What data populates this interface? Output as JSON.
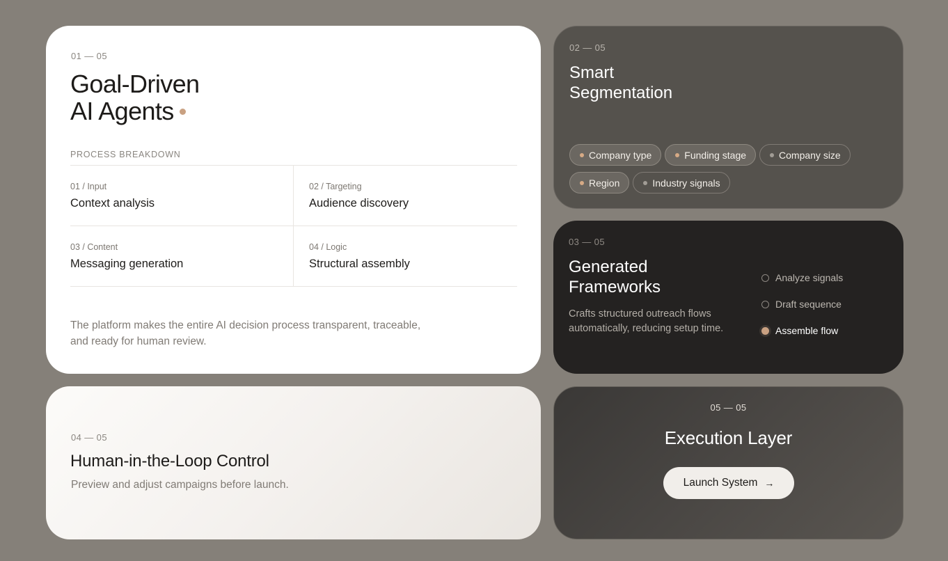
{
  "card1": {
    "step": "01 — 05",
    "title_line1": "Goal-Driven",
    "title_line2": "AI Agents",
    "section_label": "PROCESS BREAKDOWN",
    "cells": [
      {
        "caption": "01 / Input",
        "value": "Context analysis"
      },
      {
        "caption": "02 / Targeting",
        "value": "Audience discovery"
      },
      {
        "caption": "03 / Content",
        "value": "Messaging generation"
      },
      {
        "caption": "04 / Logic",
        "value": "Structural assembly"
      }
    ],
    "description": "The platform makes the entire AI decision process transparent, traceable, and ready for human review.",
    "accent_color": "#c9a182"
  },
  "card2": {
    "step": "02 — 05",
    "title_line1": "Smart",
    "title_line2": "Segmentation",
    "chips": [
      {
        "label": "Company type",
        "active": true
      },
      {
        "label": "Funding stage",
        "active": true
      },
      {
        "label": "Company size",
        "active": false
      },
      {
        "label": "Region",
        "active": true
      },
      {
        "label": "Industry signals",
        "active": false
      }
    ],
    "active_dot_color": "#d6aa85",
    "inactive_dot_color": "#a19c95"
  },
  "card3": {
    "step": "03 — 05",
    "title_line1": "Generated",
    "title_line2": "Frameworks",
    "description": "Crafts structured outreach flows automatically, reducing setup time.",
    "stages": [
      {
        "label": "Analyze signals",
        "active": false
      },
      {
        "label": "Draft sequence",
        "active": false
      },
      {
        "label": "Assemble flow",
        "active": true
      }
    ]
  },
  "card4": {
    "step": "04 — 05",
    "title": "Human-in-the-Loop Control",
    "description": "Preview and adjust campaigns before launch."
  },
  "card5": {
    "step": "05 — 05",
    "title": "Execution Layer",
    "button_label": "Launch System",
    "button_icon": "arrow-right-icon"
  }
}
